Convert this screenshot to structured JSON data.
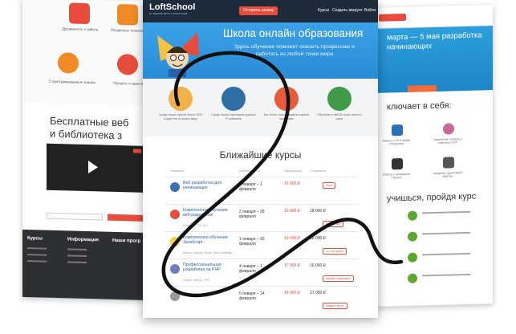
{
  "left_page": {
    "icon_captions": [
      "Душевность и забота",
      "Ресурсные технологии",
      "Структурированные знания",
      "Процесс и практика"
    ],
    "title_line1": "Бесплатные веб",
    "title_line2": "и библиотека з",
    "footer_headings": [
      "Курсы",
      "Информация",
      "Наши прогр"
    ],
    "colors": {
      "icon_red": "#e84c3d",
      "icon_orange": "#f08a24",
      "footer_bg": "#2c2f34"
    }
  },
  "header": {
    "logo": "LoftSchool",
    "logo_sub": "от мыслителя к хлопотам",
    "cta": "Оставить заявку",
    "links": [
      "Курсы",
      "Создать аккаунт",
      "Войти"
    ]
  },
  "hero": {
    "title": "Школа онлайн образования",
    "subtitle": "Здесь обучение поможет освоить профессию и работать из любой точки мира"
  },
  "tiles": [
    {
      "caption": "Среди наших курсов более 1000 студентов по всему миру",
      "color": "#f2b24a"
    },
    {
      "caption": "Среди наших партнеров крупные IT-компании",
      "color": "#2f6fa8"
    },
    {
      "caption": "Мы лично сопровождаем в вашей подготовке",
      "color": "#e85a3c"
    },
    {
      "caption": "Обучение в любой точке земного шара",
      "color": "#3f9a4a"
    }
  ],
  "courses_title": "Ближайшие курсы",
  "table_headers": [
    "Название",
    "Длительность",
    "Предоплата",
    "Стоимость"
  ],
  "courses": [
    {
      "name": "Веб разработка для начинающих",
      "tags": "",
      "date": "1 января – 1 февраля",
      "price_old": "19 000 ₽",
      "price": "",
      "button": "Хочу!",
      "icon_color": "#3d6fb5"
    },
    {
      "name": "Комплексное обучение веб-разработке",
      "tags": "HTML/JS, CSS, GIT",
      "date": "2 января – 28 февраля",
      "price_old": "19 000 ₽",
      "price": "18 000 ₽",
      "button": "Записаться",
      "icon_color": "#e84c3d"
    },
    {
      "name": "Комплексное обучение JavaScript",
      "tags": "Node.js, Angular, React, Gulp, Bootstrap",
      "date": "1 января – 20 февраля",
      "price_old": "19 000 ₽",
      "price": "18 000 ₽",
      "button": "То, что нужно!",
      "icon_color": "#f0d33a"
    },
    {
      "name": "Профессиональная разработка на PHP",
      "tags": "Laravel, MySQL, PHP",
      "date": "4 января – 1 февраля",
      "price_old": "17 000 ₽",
      "price": "16 000 ₽",
      "button": "Мужики подскажите",
      "icon_color": "#6f7ec0"
    },
    {
      "name": "",
      "tags": "",
      "date": "5 января – 14 февраля",
      "price_old": "18 000 ₽",
      "price": "17 000 ₽",
      "button": "Уведите меня!",
      "icon_color": "#9a9a9a"
    }
  ],
  "right_page": {
    "hero_title": "марта — 5 мая разработка начинающих",
    "section_title": "ключает в себя:",
    "captions": [
      "Работа с PS и Adobe Photoshop",
      "Оживление страниц с помощью CSS",
      "Работа с командной строкой",
      "Создание адаптивной вёрстки"
    ],
    "section_title2": "учишься, пройдя курс",
    "colors": {
      "ps": "#2c6fb5",
      "sass": "#cd6799",
      "case": "#333333",
      "js": "#5aa82e"
    }
  },
  "colors": {
    "nav_bg": "#1d2b3a",
    "hero": "#3ba2e6",
    "accent": "#e84c3d",
    "link": "#2a5ea6"
  }
}
